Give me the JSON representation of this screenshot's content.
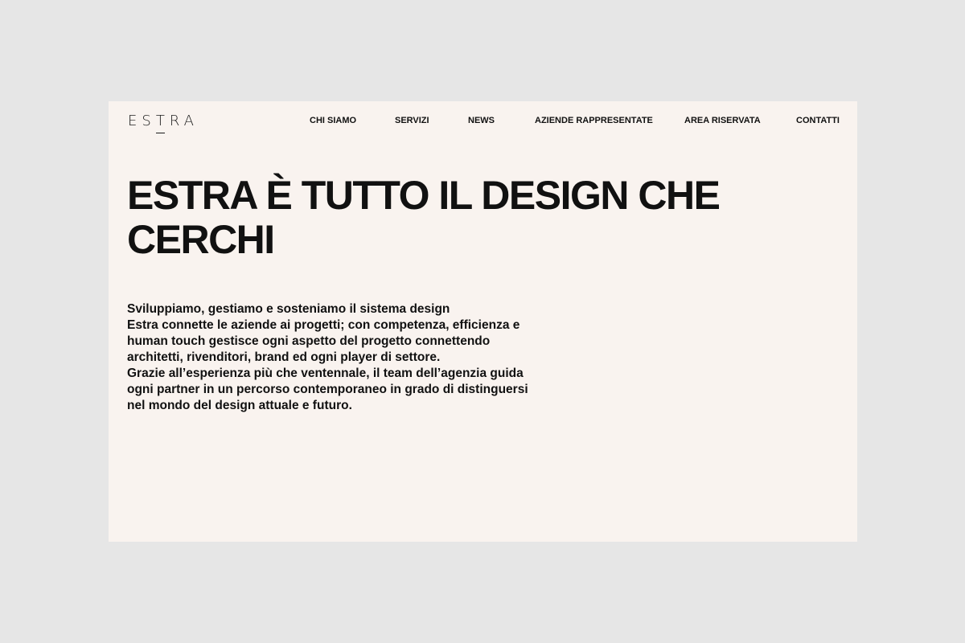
{
  "brand": {
    "logo_pre": "ES",
    "logo_t": "T",
    "logo_post": "RA"
  },
  "nav": {
    "items": [
      {
        "label": "CHI SIAMO"
      },
      {
        "label": "SERVIZI"
      },
      {
        "label": "NEWS"
      },
      {
        "label": "AZIENDE RAPPRESENTATE"
      },
      {
        "label": "AREA RISERVATA"
      },
      {
        "label": "CONTATTI"
      }
    ]
  },
  "hero": {
    "headline_line1": "ESTRA È TUTTO IL DESIGN CHE",
    "headline_line2": "CERCHI",
    "intro_lines": [
      "Sviluppiamo, gestiamo e sosteniamo il sistema design",
      "Estra connette le aziende ai progetti; con competenza, efficienza e",
      "human touch gestisce ogni aspetto del progetto connettendo",
      "architetti, rivenditori, brand ed ogni player di settore.",
      "Grazie all’esperienza più che ventennale, il team dell’agenzia guida",
      "ogni partner in un percorso contemporaneo in grado di distinguersi",
      "nel mondo del design attuale e futuro."
    ]
  },
  "colors": {
    "page_background": "#e6e6e6",
    "site_background": "#f9f3ef",
    "text": "#111111"
  }
}
